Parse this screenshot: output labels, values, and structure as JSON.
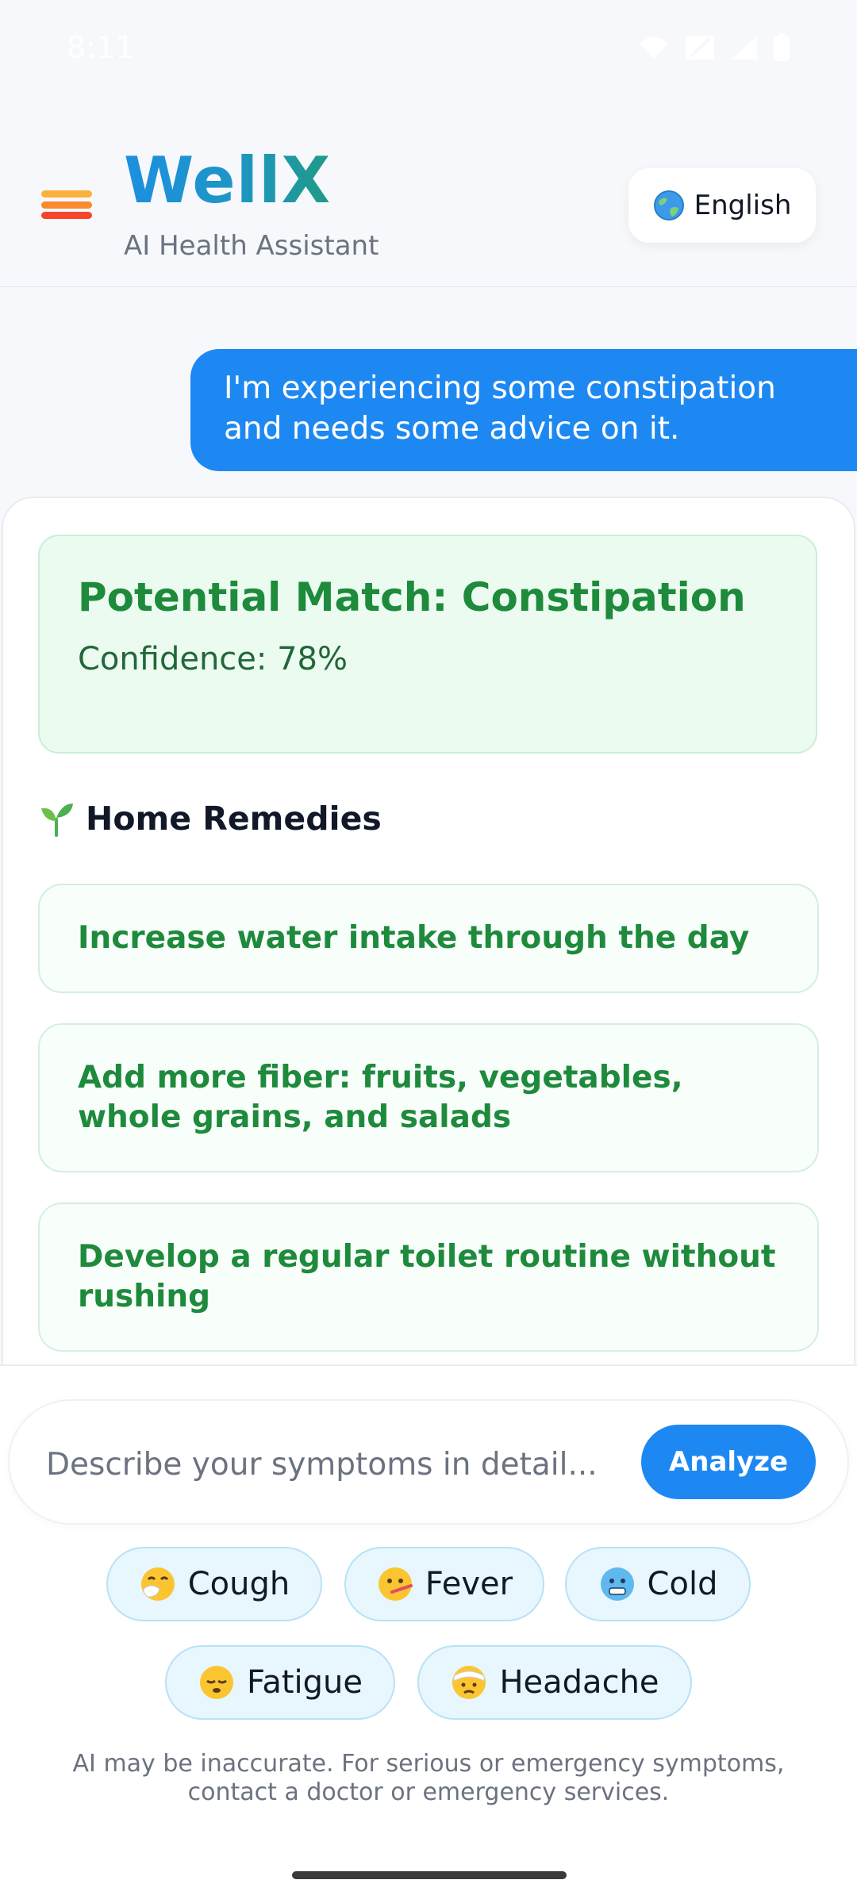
{
  "status_bar": {
    "time": "8:11"
  },
  "header": {
    "title": "WellX",
    "subtitle": "AI Health Assistant",
    "language_label": "English",
    "language_icon": "globe-icon"
  },
  "chat": {
    "user_message": "I'm experiencing some constipation and needs some advice on it.",
    "result": {
      "match_title": "Potential Match: Constipation",
      "confidence_text": "Confidence: 78%",
      "confidence_value": 78,
      "section_icon": "seedling-icon",
      "section_title": "Home Remedies",
      "remedies": [
        "Increase water intake through the day",
        "Add more fiber: fruits, vegetables, whole grains, and salads",
        "Develop a regular toilet routine without rushing"
      ]
    }
  },
  "composer": {
    "placeholder": "Describe your symptoms in detail...",
    "value": "",
    "analyze_label": "Analyze"
  },
  "quick_symptoms": [
    {
      "label": "Cough",
      "icon": "sneezing-face-icon"
    },
    {
      "label": "Fever",
      "icon": "thermometer-face-icon"
    },
    {
      "label": "Cold",
      "icon": "cold-face-icon"
    },
    {
      "label": "Fatigue",
      "icon": "sleepy-face-icon"
    },
    {
      "label": "Headache",
      "icon": "bandage-head-face-icon"
    }
  ],
  "disclaimer": "AI may be inaccurate. For serious or emergency symptoms, contact a doctor or emergency services.",
  "colors": {
    "brand_blue": "#1e88f2",
    "brand_teal": "#1f9a86",
    "success_green": "#1e8a3c",
    "match_bg": "#ebfbef",
    "chip_bg": "#e8f6fd"
  }
}
